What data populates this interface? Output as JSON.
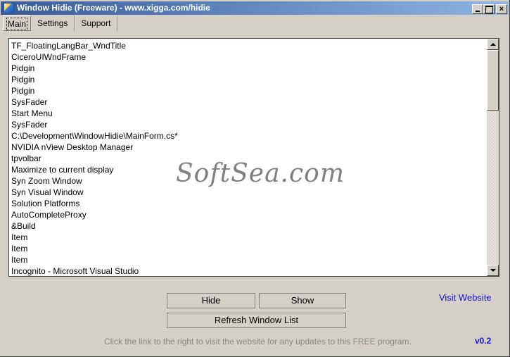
{
  "window": {
    "title": "Window Hidie (Freeware) - www.xigga.com/hidie",
    "icon": "app-icon",
    "controls": {
      "minimize": "minimize-icon",
      "maximize": "maximize-icon",
      "close": "×"
    }
  },
  "tabs": [
    {
      "label": "Main",
      "active": true
    },
    {
      "label": "Settings",
      "active": false
    },
    {
      "label": "Support",
      "active": false
    }
  ],
  "window_list": {
    "items": [
      "TF_FloatingLangBar_WndTitle",
      "CiceroUIWndFrame",
      "Pidgin",
      "Pidgin",
      "Pidgin",
      "SysFader",
      "Start Menu",
      "SysFader",
      "C:\\Development\\WindowHidie\\MainForm.cs*",
      "NVIDIA nView Desktop Manager",
      "tpvolbar",
      "Maximize to current display",
      "Syn Zoom Window",
      "Syn Visual Window",
      "Solution Platforms",
      "AutoCompleteProxy",
      "&Build",
      "Item",
      "Item",
      "Item",
      "Incognito - Microsoft Visual Studio"
    ],
    "scrollbar": {
      "up": "arrow-up-icon",
      "down": "arrow-down-icon"
    }
  },
  "watermark": "SoftSea.com",
  "buttons": {
    "hide": "Hide",
    "show": "Show",
    "refresh": "Refresh Window List"
  },
  "links": {
    "visit_website": "Visit Website"
  },
  "footer": {
    "note": "Click the link to the right to visit the website for any updates to this FREE program.",
    "version": "v0.2"
  },
  "colors": {
    "link": "#1515c8",
    "note": "#8a8a8a",
    "face": "#d4d0c8"
  }
}
